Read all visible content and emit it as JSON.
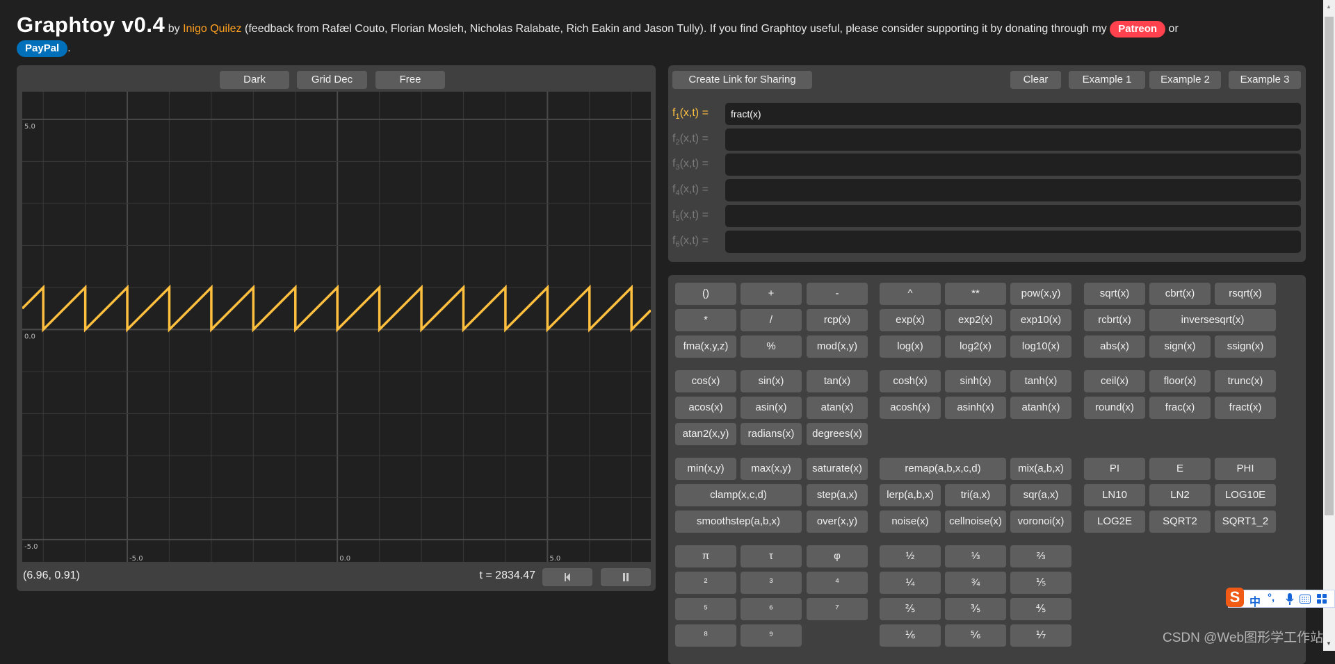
{
  "header": {
    "title": "Graphtoy v0.4",
    "by": "by",
    "author": "Inigo Quilez",
    "credits": "(feedback from Rafæl Couto, Florian Mosleh, Nicholas Ralabate, Rich Eakin and Jason Tully). If you find Graphtoy useful, please consider supporting it by donating through my",
    "patreon": "Patreon",
    "or": "or",
    "paypal": "PayPal",
    "period": "."
  },
  "colors": {
    "accent": "#ffc040",
    "patreon": "#ff424d",
    "paypal": "#0070ba",
    "author": "#ffa020"
  },
  "graph_toolbar": {
    "theme": "Dark",
    "grid": "Grid Dec",
    "mode": "Free"
  },
  "chart_data": {
    "type": "line",
    "series": [
      {
        "name": "f1(x,t) = fract(x)",
        "expression": "fract(x)",
        "color": "#ffc040"
      }
    ],
    "xlim": [
      -7.5,
      7.46
    ],
    "ylim": [
      -5.53,
      5.66
    ],
    "x_tick_labels": [
      "-5.0",
      "0.0",
      "5.0"
    ],
    "y_tick_labels": [
      "5.0",
      "0.0",
      "-5.0"
    ],
    "grid": true,
    "grid_step": 1
  },
  "status": {
    "coords": "(6.96, 0.91)",
    "time": "t = 2834.47",
    "rewind_icon": "skip-back-icon",
    "pause_icon": "pause-icon"
  },
  "share_bar": {
    "share": "Create Link for Sharing",
    "clear": "Clear",
    "ex1": "Example 1",
    "ex2": "Example 2",
    "ex3": "Example 3"
  },
  "functions": [
    {
      "name": "f",
      "sub": "1",
      "args": "(x,t) =",
      "value": "fract(x)",
      "active": true
    },
    {
      "name": "f",
      "sub": "2",
      "args": "(x,t) =",
      "value": "",
      "active": false
    },
    {
      "name": "f",
      "sub": "3",
      "args": "(x,t) =",
      "value": "",
      "active": false
    },
    {
      "name": "f",
      "sub": "4",
      "args": "(x,t) =",
      "value": "",
      "active": false
    },
    {
      "name": "f",
      "sub": "5",
      "args": "(x,t) =",
      "value": "",
      "active": false
    },
    {
      "name": "f",
      "sub": "6",
      "args": "(x,t) =",
      "value": "",
      "active": false
    }
  ],
  "keyboard": [
    [
      "()",
      "+",
      "-",
      "^",
      "**",
      "pow(x,y)",
      "sqrt(x)",
      "cbrt(x)",
      "rsqrt(x)"
    ],
    [
      "*",
      "/",
      "rcp(x)",
      "exp(x)",
      "exp2(x)",
      "exp10(x)",
      "rcbrt(x)",
      "inversesqrt(x)"
    ],
    [
      "fma(x,y,z)",
      "%",
      "mod(x,y)",
      "log(x)",
      "log2(x)",
      "log10(x)",
      "abs(x)",
      "sign(x)",
      "ssign(x)"
    ],
    [
      "cos(x)",
      "sin(x)",
      "tan(x)",
      "cosh(x)",
      "sinh(x)",
      "tanh(x)",
      "ceil(x)",
      "floor(x)",
      "trunc(x)"
    ],
    [
      "acos(x)",
      "asin(x)",
      "atan(x)",
      "acosh(x)",
      "asinh(x)",
      "atanh(x)",
      "round(x)",
      "frac(x)",
      "fract(x)"
    ],
    [
      "atan2(x,y)",
      "radians(x)",
      "degrees(x)"
    ],
    [
      "min(x,y)",
      "max(x,y)",
      "saturate(x)",
      "remap(a,b,x,c,d)",
      "mix(a,b,x)",
      "PI",
      "E",
      "PHI"
    ],
    [
      "clamp(x,c,d)",
      "step(a,x)",
      "lerp(a,b,x)",
      "tri(a,x)",
      "sqr(a,x)",
      "LN10",
      "LN2",
      "LOG10E"
    ],
    [
      "smoothstep(a,b,x)",
      "over(x,y)",
      "noise(x)",
      "cellnoise(x)",
      "voronoi(x)",
      "LOG2E",
      "SQRT2",
      "SQRT1_2"
    ],
    [
      "π",
      "τ",
      "φ",
      "½",
      "⅓",
      "⅔"
    ],
    [
      "²",
      "³",
      "⁴",
      "¼",
      "¾",
      "⅕"
    ],
    [
      "⁵",
      "⁶",
      "⁷",
      "⅖",
      "⅗",
      "⅘"
    ],
    [
      "⁸",
      "⁹",
      null,
      "⅙",
      "⅚",
      "⅐"
    ]
  ],
  "ime": {
    "logo": "S",
    "lang": "中",
    "punct": "°,",
    "mic_icon": "microphone-icon",
    "keyboard_icon": "keyboard-icon",
    "apps_icon": "grid-icon"
  },
  "watermark": "CSDN @Web图形学工作站"
}
